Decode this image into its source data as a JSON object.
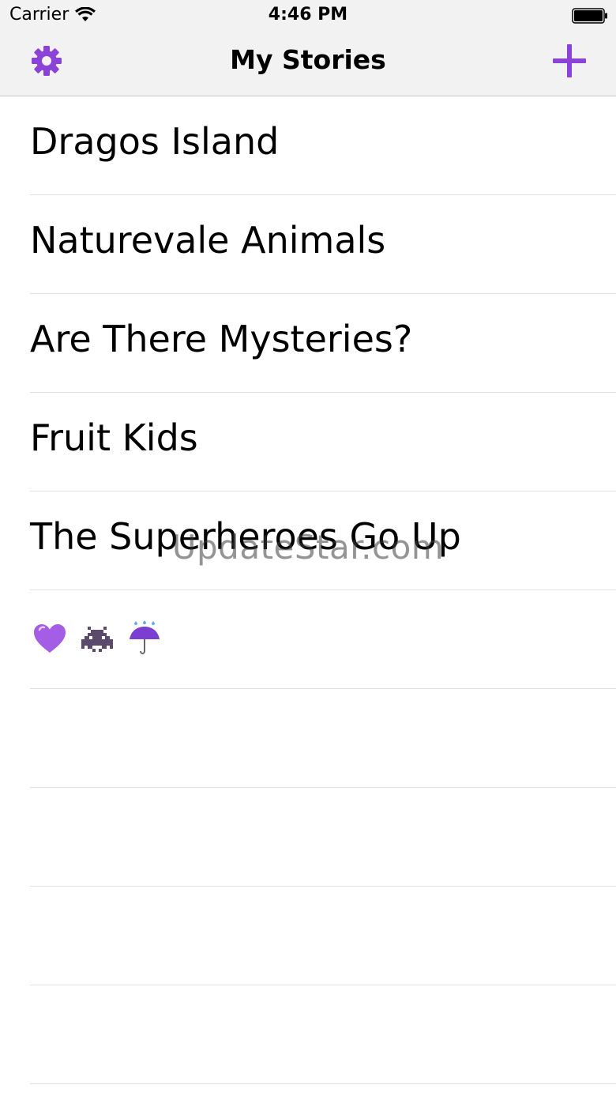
{
  "status_bar": {
    "carrier": "Carrier",
    "time": "4:46 PM"
  },
  "nav": {
    "title": "My Stories",
    "settings_icon": "gear-icon",
    "add_icon": "plus-icon",
    "accent_color": "#8b42d9"
  },
  "stories": [
    {
      "title": "Dragos Island"
    },
    {
      "title": "Naturevale Animals"
    },
    {
      "title": "Are There Mysteries?"
    },
    {
      "title": "Fruit Kids"
    },
    {
      "title": "The Superheroes Go Up"
    }
  ],
  "emoji_row": {
    "icons": [
      "purple-heart-icon",
      "space-invader-icon",
      "umbrella-rain-icon"
    ]
  },
  "watermark": "UpdateStar.com"
}
